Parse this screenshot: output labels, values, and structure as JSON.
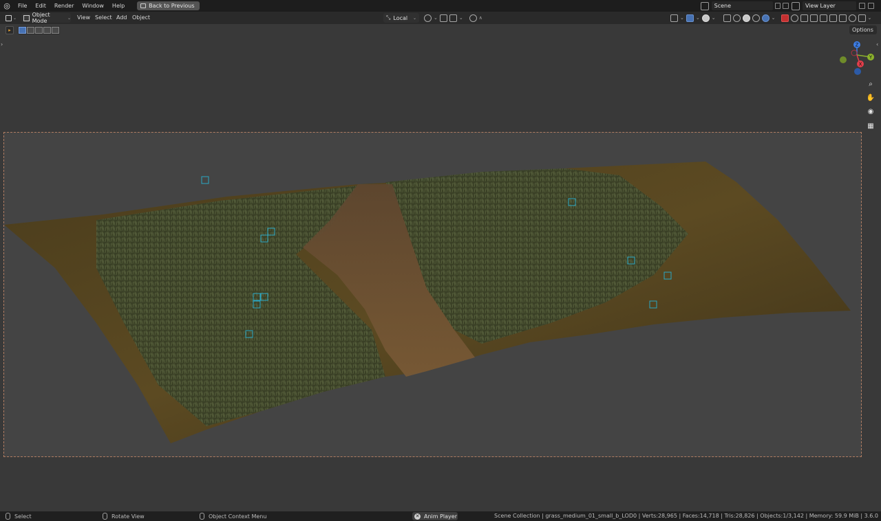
{
  "topbar": {
    "menus": [
      "File",
      "Edit",
      "Render",
      "Window",
      "Help"
    ],
    "back_label": "Back to Previous",
    "scene_name": "Scene",
    "view_layer": "View Layer"
  },
  "viewport_header": {
    "mode": "Object Mode",
    "menus": [
      "View",
      "Select",
      "Add",
      "Object"
    ],
    "pivot": "Local",
    "options_label": "Options"
  },
  "gizmo": {
    "x_label": "X",
    "y_label": "Y",
    "z_label": "Z",
    "colors": {
      "x": "#e23e4b",
      "y": "#8cb22c",
      "z": "#3d7ee6"
    }
  },
  "statusbar": {
    "select": "Select",
    "rotate": "Rotate View",
    "context_menu": "Object Context Menu",
    "anim_player": "Anim Player",
    "stats": "Scene Collection | grass_medium_01_small_b_LOD0 | Verts:28,965 | Faces:14,718 | Tris:28,826 | Objects:1/3,142 | Memory: 59.9 MiB | 3.6.0"
  },
  "colors": {
    "accent": "#4772b3",
    "camera_frame": "#c88a6a",
    "marker": "#2aa7c4"
  }
}
